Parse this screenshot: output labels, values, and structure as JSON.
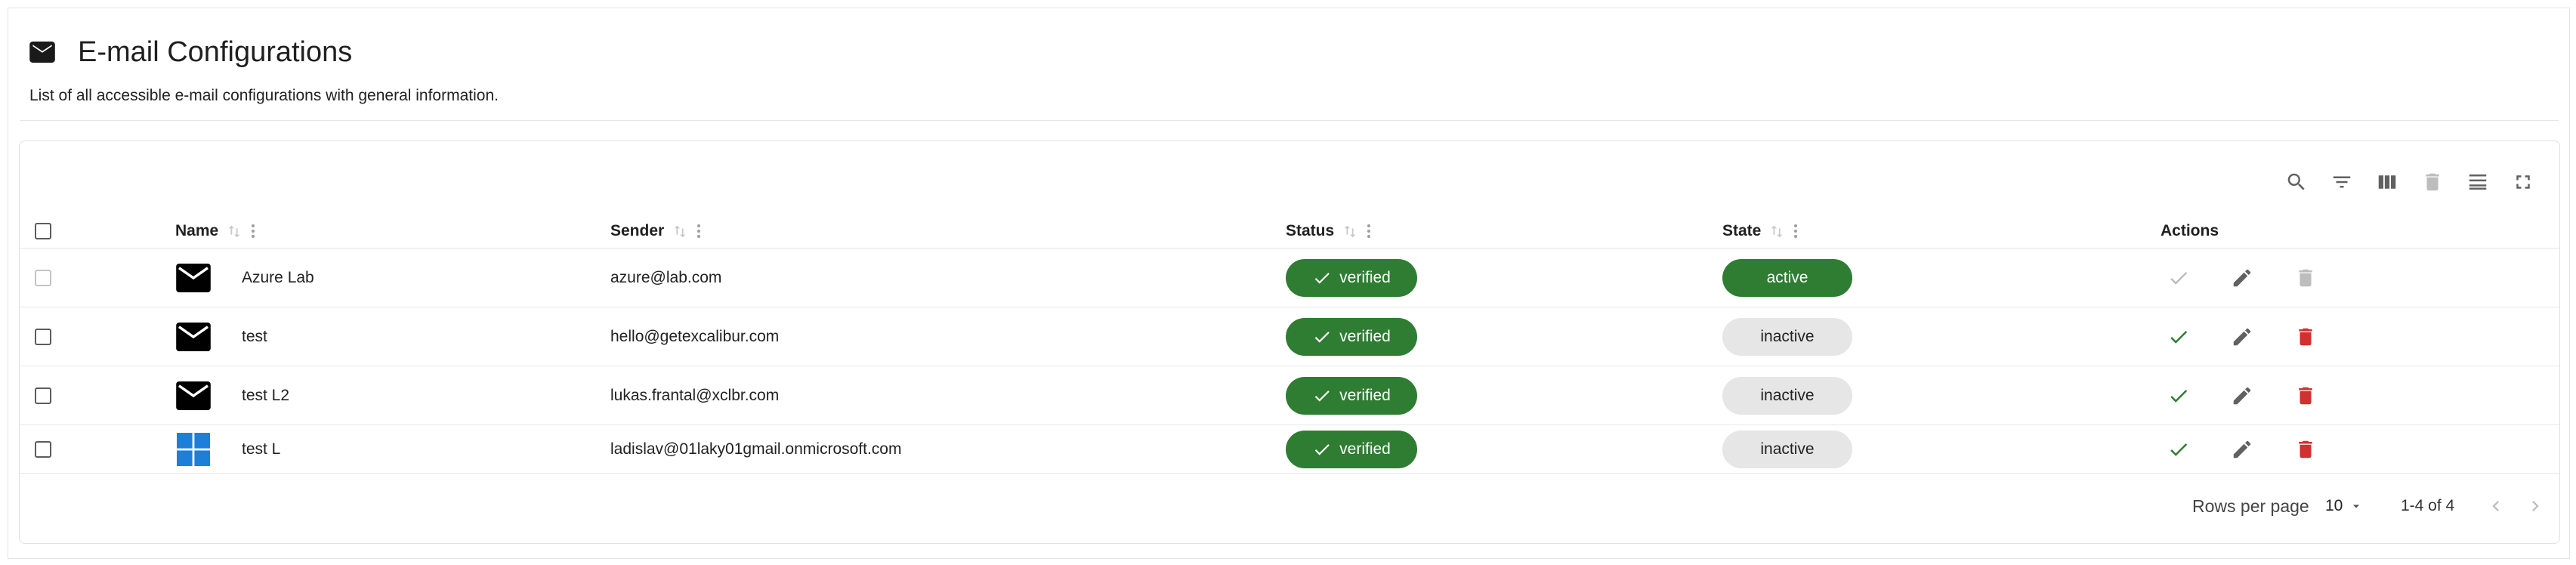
{
  "header": {
    "icon": "envelope-icon",
    "title": "E-mail Configurations",
    "subtitle": "List of all accessible e-mail configurations with general information."
  },
  "toolbar": {
    "icons": [
      "search-icon",
      "filter-icon",
      "columns-icon",
      "delete-icon",
      "density-icon",
      "fullscreen-icon"
    ]
  },
  "table": {
    "columns": {
      "name": "Name",
      "sender": "Sender",
      "status": "Status",
      "state": "State",
      "actions": "Actions"
    },
    "rows": [
      {
        "icon": "envelope-icon",
        "name": "Azure Lab",
        "sender": "azure@lab.com",
        "status": "verified",
        "state": "active"
      },
      {
        "icon": "envelope-icon",
        "name": "test",
        "sender": "hello@getexcalibur.com",
        "status": "verified",
        "state": "inactive"
      },
      {
        "icon": "envelope-icon",
        "name": "test L2",
        "sender": "lukas.frantal@xclbr.com",
        "status": "verified",
        "state": "inactive"
      },
      {
        "icon": "windows-icon",
        "name": "test L",
        "sender": "ladislav@01laky01gmail.onmicrosoft.com",
        "status": "verified",
        "state": "inactive"
      }
    ]
  },
  "pagination": {
    "rows_per_page_label": "Rows per page",
    "rows_per_page_value": "10",
    "range": "1-4 of 4"
  },
  "colors": {
    "accent_green": "#2e7d32",
    "delete_red": "#d32f2f",
    "icon_grey": "#616161",
    "disabled_grey": "#bdbdbd",
    "windows_blue": "#1e7fd8"
  }
}
